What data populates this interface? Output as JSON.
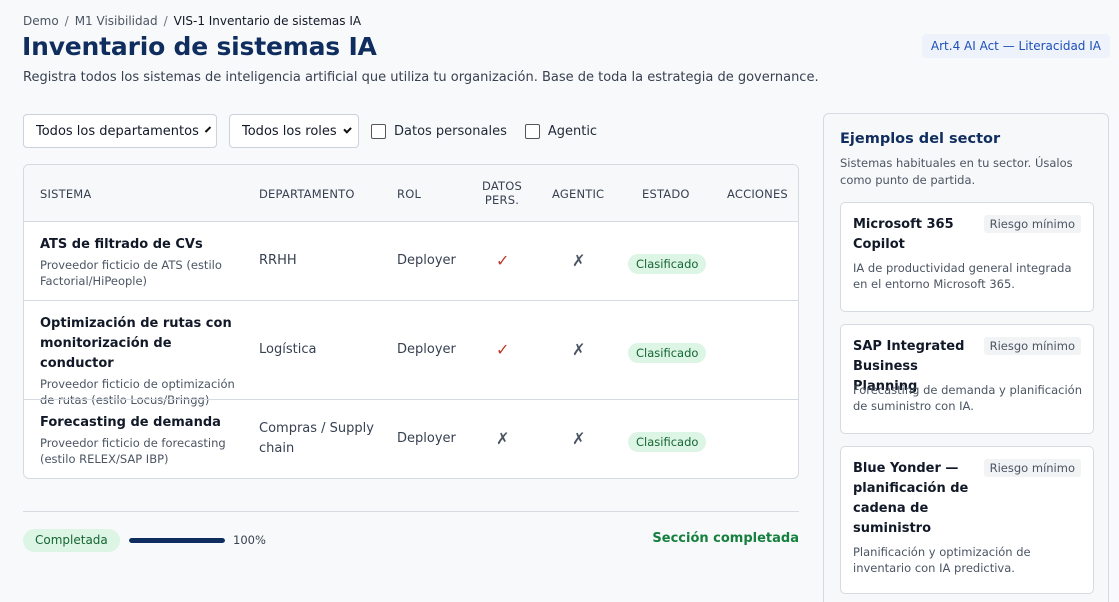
{
  "breadcrumb": {
    "items": [
      "Demo",
      "M1 Visibilidad",
      "VIS-1 Inventario de sistemas IA"
    ],
    "separator": "/"
  },
  "header": {
    "title": "Inventario de sistemas IA",
    "badge": "Art.4 AI Act — Literacidad IA",
    "subtitle": "Registra todos los sistemas de inteligencia artificial que utiliza tu organización. Base de toda la estrategia de governance."
  },
  "filters": {
    "department_select": "Todos los departamentos",
    "role_select": "Todos los roles",
    "personal_data_label": "Datos personales",
    "personal_data_checked": false,
    "agentic_label": "Agentic",
    "agentic_checked": false
  },
  "table": {
    "headers": {
      "system": "SISTEMA",
      "department": "DEPARTAMENTO",
      "role": "ROL",
      "personal_data_line1": "DATOS",
      "personal_data_line2": "PERS.",
      "agentic": "AGENTIC",
      "status": "ESTADO",
      "actions": "ACCIONES"
    },
    "rows": [
      {
        "name": "ATS de filtrado de CVs",
        "description": "Proveedor ficticio de ATS (estilo Factorial/HiPeople)",
        "department": "RRHH",
        "role": "Deployer",
        "personal_data": "✓",
        "agentic": "✗",
        "status": "Clasificado"
      },
      {
        "name": "Optimización de rutas con monitorización de conductor",
        "description": "Proveedor ficticio de optimización de rutas (estilo Locus/Bringg)",
        "department": "Logística",
        "role": "Deployer",
        "personal_data": "✓",
        "agentic": "✗",
        "status": "Clasificado"
      },
      {
        "name": "Forecasting de demanda",
        "description": "Proveedor ficticio de forecasting (estilo RELEX/SAP IBP)",
        "department": "Compras / Supply chain",
        "role": "Deployer",
        "personal_data": "✗",
        "agentic": "✗",
        "status": "Clasificado"
      }
    ]
  },
  "footer": {
    "status": "Completada",
    "progress_percent": 100,
    "progress_label": "100%",
    "section_status": "Sección completada"
  },
  "sidebar": {
    "title": "Ejemplos del sector",
    "subtitle": "Sistemas habituales en tu sector. Úsalos como punto de partida.",
    "cards": [
      {
        "name": "Microsoft 365 Copilot",
        "risk": "Riesgo mínimo",
        "description": "IA de productividad general integrada en el entorno Microsoft 365."
      },
      {
        "name": "SAP Integrated Business Planning",
        "risk": "Riesgo mínimo",
        "description": "Forecasting de demanda y planificación de suministro con IA."
      },
      {
        "name": "Blue Yonder — planificación de cadena de suministro",
        "risk": "Riesgo mínimo",
        "description": "Planificación y optimización de inventario con IA predictiva."
      }
    ]
  },
  "colors": {
    "brand": "#0f2d5e",
    "success_bg": "#dcf5e4",
    "success_text": "#166534",
    "yes_mark": "#c0392b"
  }
}
